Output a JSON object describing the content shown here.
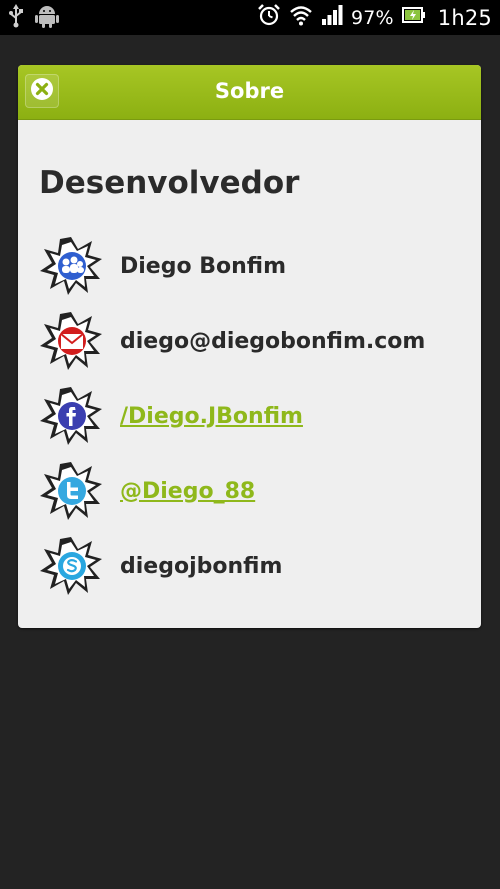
{
  "status_bar": {
    "battery_percent": "97%",
    "time": "1h25",
    "icons": [
      "usb-icon",
      "android-icon",
      "alarm-icon",
      "wifi-icon",
      "signal-icon",
      "battery-icon"
    ]
  },
  "dialog": {
    "title": "Sobre",
    "close_icon": "close-icon",
    "section_title": "Desenvolvedor",
    "accent_color": "#9dbd1f",
    "contacts": [
      {
        "icon": "myspace-people-icon",
        "text": "Diego Bonfim",
        "link": false
      },
      {
        "icon": "email-icon",
        "text": "diego@diegobonfim.com",
        "link": false
      },
      {
        "icon": "facebook-icon",
        "text": "/Diego.JBonfim",
        "link": true
      },
      {
        "icon": "twitter-icon",
        "text": "@Diego_88",
        "link": true
      },
      {
        "icon": "skype-icon",
        "text": "diegojbonfim",
        "link": false
      }
    ]
  }
}
